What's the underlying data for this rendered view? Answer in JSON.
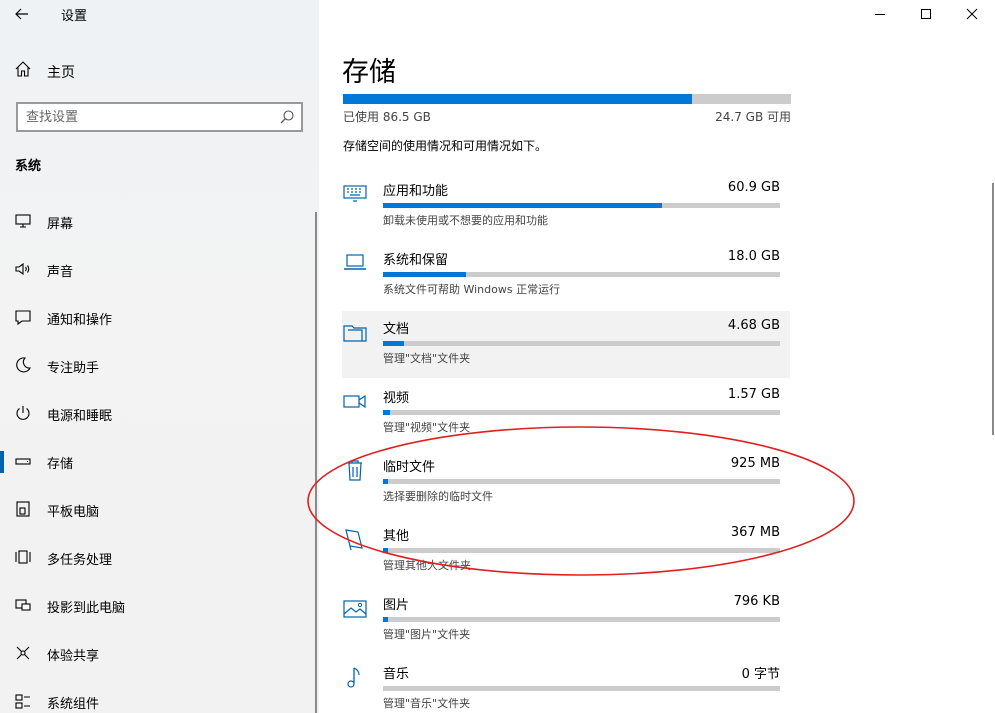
{
  "window": {
    "title": "设置",
    "controls": [
      "minimize",
      "maximize",
      "close"
    ]
  },
  "sidebar": {
    "home_label": "主页",
    "search": {
      "placeholder": "查找设置",
      "value": ""
    },
    "section": "系统",
    "items": [
      {
        "label": "屏幕",
        "icon": "display-icon"
      },
      {
        "label": "声音",
        "icon": "speaker-icon"
      },
      {
        "label": "通知和操作",
        "icon": "notification-icon"
      },
      {
        "label": "专注助手",
        "icon": "moon-icon"
      },
      {
        "label": "电源和睡眠",
        "icon": "power-icon"
      },
      {
        "label": "存储",
        "icon": "storage-icon",
        "active": true
      },
      {
        "label": "平板电脑",
        "icon": "tablet-icon"
      },
      {
        "label": "多任务处理",
        "icon": "multitask-icon"
      },
      {
        "label": "投影到此电脑",
        "icon": "project-icon"
      },
      {
        "label": "体验共享",
        "icon": "share-icon"
      },
      {
        "label": "系统组件",
        "icon": "components-icon"
      }
    ]
  },
  "main": {
    "title": "存储",
    "used_label": "已使用 86.5 GB",
    "free_label": "24.7 GB 可用",
    "used_fraction": 0.778,
    "description": "存储空间的使用情况和可用情况如下。",
    "categories": [
      {
        "name": "应用和功能",
        "size": "60.9 GB",
        "sub": "卸载未使用或不想要的应用和功能",
        "fraction": 0.704,
        "icon": "apps-icon"
      },
      {
        "name": "系统和保留",
        "size": "18.0 GB",
        "sub": "系统文件可帮助 Windows 正常运行",
        "fraction": 0.208,
        "icon": "laptop-icon"
      },
      {
        "name": "文档",
        "size": "4.68 GB",
        "sub": "管理\"文档\"文件夹",
        "fraction": 0.054,
        "icon": "documents-icon",
        "hover": true
      },
      {
        "name": "视频",
        "size": "1.57 GB",
        "sub": "管理\"视频\"文件夹",
        "fraction": 0.018,
        "icon": "video-icon"
      },
      {
        "name": "临时文件",
        "size": "925 MB",
        "sub": "选择要删除的临时文件",
        "fraction": 0.011,
        "icon": "trash-icon"
      },
      {
        "name": "其他",
        "size": "367 MB",
        "sub": "管理其他大文件夹",
        "fraction": 0.005,
        "icon": "other-icon"
      },
      {
        "name": "图片",
        "size": "796 KB",
        "sub": "管理\"图片\"文件夹",
        "fraction": 0.001,
        "icon": "pictures-icon"
      },
      {
        "name": "音乐",
        "size": "0 字节",
        "sub": "管理\"音乐\"文件夹",
        "fraction": 0.0,
        "icon": "music-icon"
      }
    ]
  },
  "colors": {
    "accent": "#0078d7",
    "bar_track": "#cccccc",
    "annotation": "#e02020"
  }
}
